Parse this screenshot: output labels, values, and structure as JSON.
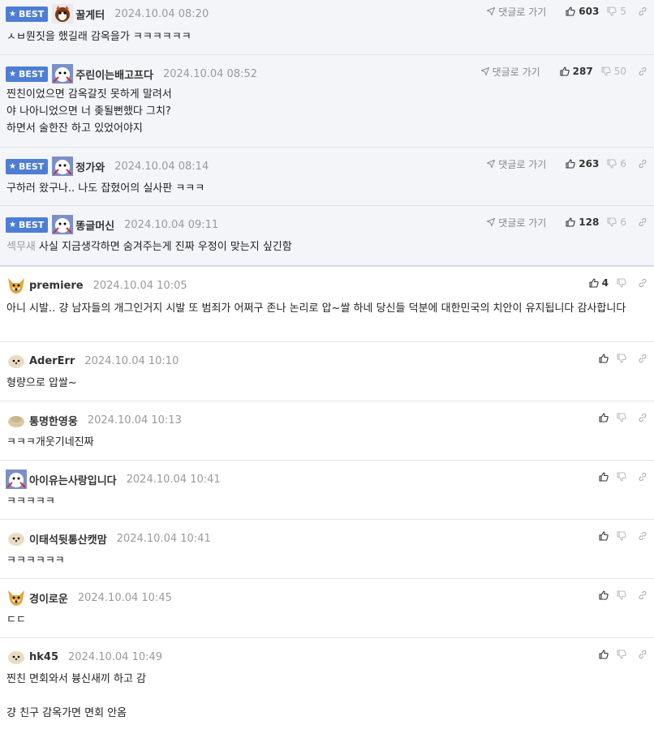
{
  "icons": {
    "goto": "navigate-arrow-icon",
    "like": "thumbs-up-icon",
    "dislike": "thumbs-down-icon",
    "share": "link-icon",
    "badge": "star-icon"
  },
  "colors": {
    "best_badge": "#4d7ed6",
    "best_bg": "#f3f5f8"
  },
  "labels": {
    "best": "BEST",
    "goto_comment": "댓글로 가기"
  },
  "best_comments": [
    {
      "nick": "꿀게터",
      "date": "2024.10.04 08:20",
      "likes": "603",
      "dislikes": "5",
      "lines": [
        "ㅅㅂ뭔짓을 했길래 감옥을가 ㅋㅋㅋㅋㅋㅋ"
      ]
    },
    {
      "nick": "주린이는배고프다",
      "date": "2024.10.04 08:52",
      "likes": "287",
      "dislikes": "50",
      "lines": [
        "찐친이었으면 감옥갈짓 못하게 말려서",
        "야 나아니었으면 너 좆될뻔했다 그치?",
        "하면서 술한잔 하고 있었어야지"
      ]
    },
    {
      "nick": "정가와",
      "date": "2024.10.04 08:14",
      "likes": "263",
      "dislikes": "6",
      "lines": [
        "구하러 왔구나.. 나도 잡혔어의 실사판 ㅋㅋㅋ"
      ]
    },
    {
      "nick": "똥글머신",
      "date": "2024.10.04 09:11",
      "likes": "128",
      "dislikes": "6",
      "prefix": "섹무새",
      "lines": [
        "사실 지금생각하면 숨겨주는게 진짜 우정이 맞는지 싶긴함"
      ]
    }
  ],
  "comments": [
    {
      "nick": "premiere",
      "date": "2024.10.04 10:05",
      "likes": "4",
      "lines": [
        "아니 시발.. 걍 남자들의 개그인거지 시발 또 범죄가 어쩌구 존나 논리로 압~쌀 하네 당신들 덕분에 대한민국의 치안이 유지됩니다 감사합니다"
      ]
    },
    {
      "nick": "AderErr",
      "date": "2024.10.04 10:10",
      "likes": "",
      "lines": [
        "형량으로 압쌀~"
      ]
    },
    {
      "nick": "통명한영웅",
      "date": "2024.10.04 10:13",
      "likes": "",
      "lines": [
        "ㅋㅋㅋ개웃기네진짜"
      ]
    },
    {
      "nick": "아이유는사랑입니다",
      "date": "2024.10.04 10:41",
      "likes": "",
      "lines": [
        "ㅋㅋㅋㅋㅋ"
      ]
    },
    {
      "nick": "이태석뒷통산캣맘",
      "date": "2024.10.04 10:41",
      "likes": "",
      "lines": [
        "ㅋㅋㅋㅋㅋㅋ"
      ]
    },
    {
      "nick": "경이로운",
      "date": "2024.10.04 10:45",
      "likes": "",
      "lines": [
        "ㄷㄷ"
      ]
    },
    {
      "nick": "hk45",
      "date": "2024.10.04 10:49",
      "likes": "",
      "lines": [
        "찐친 면회와서 븅신새끼 하고 감",
        "",
        "걍 친구 감옥가면 면회 안옴"
      ]
    }
  ]
}
